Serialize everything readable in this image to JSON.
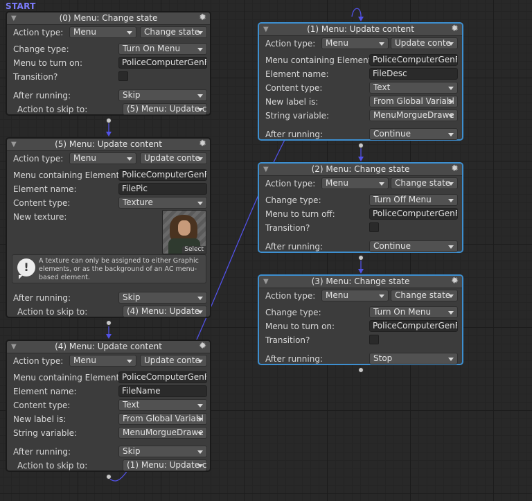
{
  "start_label": "START",
  "nodes": [
    {
      "title": "(0) Menu: Change state",
      "rows": [
        {
          "label": "Action type:",
          "v1": "Menu",
          "v2": "Change state"
        },
        {
          "label": "Change type:",
          "value": "Turn On Menu"
        },
        {
          "label": "Menu to turn on:",
          "value": "PoliceComputerGenFi"
        },
        {
          "label": "Transition?"
        },
        {
          "label": "After running:",
          "value": "Skip"
        },
        {
          "label": "Action to skip to:",
          "value": "(5) Menu: Update c"
        }
      ]
    },
    {
      "title": "(5) Menu: Update content",
      "rows": [
        {
          "label": "Action type:",
          "v1": "Menu",
          "v2": "Update conte"
        },
        {
          "label": "Menu containing Element:",
          "value": "PoliceComputerGenFi"
        },
        {
          "label": "Element name:",
          "value": "FilePic"
        },
        {
          "label": "Content type:",
          "value": "Texture"
        },
        {
          "label": "New texture:",
          "select": "Select"
        },
        {
          "label": "After running:",
          "value": "Skip"
        },
        {
          "label": "Action to skip to:",
          "value": "(4) Menu: Update"
        }
      ],
      "help": "A texture can only be assigned to either Graphic elements, or as the background of an AC menu-based element."
    },
    {
      "title": "(4) Menu: Update content",
      "rows": [
        {
          "label": "Action type:",
          "v1": "Menu",
          "v2": "Update conte"
        },
        {
          "label": "Menu containing Element:",
          "value": "PoliceComputerGenFi"
        },
        {
          "label": "Element name:",
          "value": "FileName"
        },
        {
          "label": "Content type:",
          "value": "Text"
        },
        {
          "label": "New label is:",
          "value": "From Global Variabl"
        },
        {
          "label": "String variable:",
          "value": "MenuMorgueDrawe"
        },
        {
          "label": "After running:",
          "value": "Skip"
        },
        {
          "label": "Action to skip to:",
          "value": "(1) Menu: Update c"
        }
      ]
    },
    {
      "title": "(1) Menu: Update content",
      "rows": [
        {
          "label": "Action type:",
          "v1": "Menu",
          "v2": "Update conte"
        },
        {
          "label": "Menu containing Element:",
          "value": "PoliceComputerGenFi"
        },
        {
          "label": "Element name:",
          "value": "FileDesc"
        },
        {
          "label": "Content type:",
          "value": "Text"
        },
        {
          "label": "New label is:",
          "value": "From Global Variabl"
        },
        {
          "label": "String variable:",
          "value": "MenuMorgueDrawe"
        },
        {
          "label": "After running:",
          "value": "Continue"
        }
      ]
    },
    {
      "title": "(2) Menu: Change state",
      "rows": [
        {
          "label": "Action type:",
          "v1": "Menu",
          "v2": "Change state"
        },
        {
          "label": "Change type:",
          "value": "Turn Off Menu"
        },
        {
          "label": "Menu to turn off:",
          "value": "PoliceComputerGenFi"
        },
        {
          "label": "Transition?"
        },
        {
          "label": "After running:",
          "value": "Continue"
        }
      ]
    },
    {
      "title": "(3) Menu: Change state",
      "rows": [
        {
          "label": "Action type:",
          "v1": "Menu",
          "v2": "Change state"
        },
        {
          "label": "Change type:",
          "value": "Turn On Menu"
        },
        {
          "label": "Menu to turn on:",
          "value": "PoliceComputerGenFi"
        },
        {
          "label": "Transition?"
        },
        {
          "label": "After running:",
          "value": "Stop"
        }
      ]
    }
  ]
}
